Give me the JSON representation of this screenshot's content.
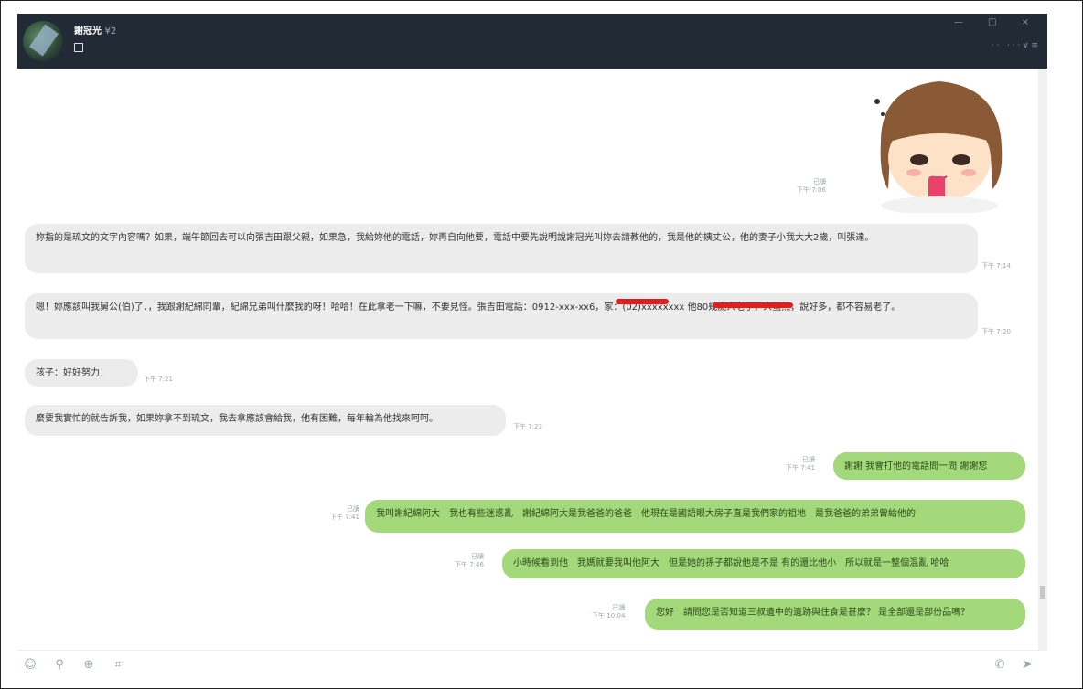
{
  "window": {
    "contact_name": "謝冠光",
    "contact_tag": "¥2",
    "controls": "— □ ×",
    "status_text": "· · · · · ·  ∨ ≡"
  },
  "messages": {
    "sticker_meta": {
      "read": "已讀",
      "time": "下午 7:06"
    },
    "in1": {
      "text": "妳指的是琉文的文字內容嗎？如果，端午節回去可以向張吉田跟父親，如果急，我給妳他的電話，妳再自向他要，電話中要先說明說謝冠光叫妳去請教他的，我是他的姨丈公，他的妻子小我大大2歲，叫張達。",
      "time": "下午 7:14"
    },
    "in2": {
      "text": "嗯！妳應該叫我舅公(伯)了．，我跟謝紀綿同輩，紀綿兄弟叫什麼我的呀！哈哈！在此拿老一下嘛，不要見怪。張吉田電話：0912-xxx-xx6，家：(02)xxxxxxxx 他80幾歲人老了，人蠻熱，說好多，都不容易老了。",
      "time": "下午 7:20"
    },
    "in3": {
      "text": "孩子：好好努力！",
      "time": "下午 7:21"
    },
    "in4": {
      "text": "麼要我實忙的就告訴我，如果妳拿不到琉文，我去拿應該會給我，他有困難，每年輪為他找來呵呵。",
      "time": "下午 7:23"
    },
    "out1": {
      "text": "謝謝 我會打他的電話問一問 謝謝您",
      "read": "已讀",
      "time": "下午 7:41"
    },
    "out2": {
      "text": "我叫謝紀綿阿大　我也有些迷惑亂　謝紀綿阿大是我爸爸的爸爸　他現在是國語眼大房子直是我們家的祖地　是我爸爸的弟弟曾給他的",
      "read": "已讀",
      "time": "下午 7:41"
    },
    "out3": {
      "text": "小時候看到他　我媽就要我叫他阿大　但是她的孫子都說他是不是 有的還比他小　所以就是一整個混亂 哈哈",
      "read": "已讀",
      "time": "下午 7:46"
    },
    "out4": {
      "text": "您好　請問您是否知道三叔遺中的遺跡與住食是甚麼？ 是全部還是部份品嗎？",
      "read": "已讀",
      "time": "下午 10:04"
    }
  },
  "bottom": {
    "emoji": "☺",
    "attach": "⚲",
    "plus": "⊕",
    "crop": "⌗",
    "call": "✆",
    "send": "➤"
  }
}
